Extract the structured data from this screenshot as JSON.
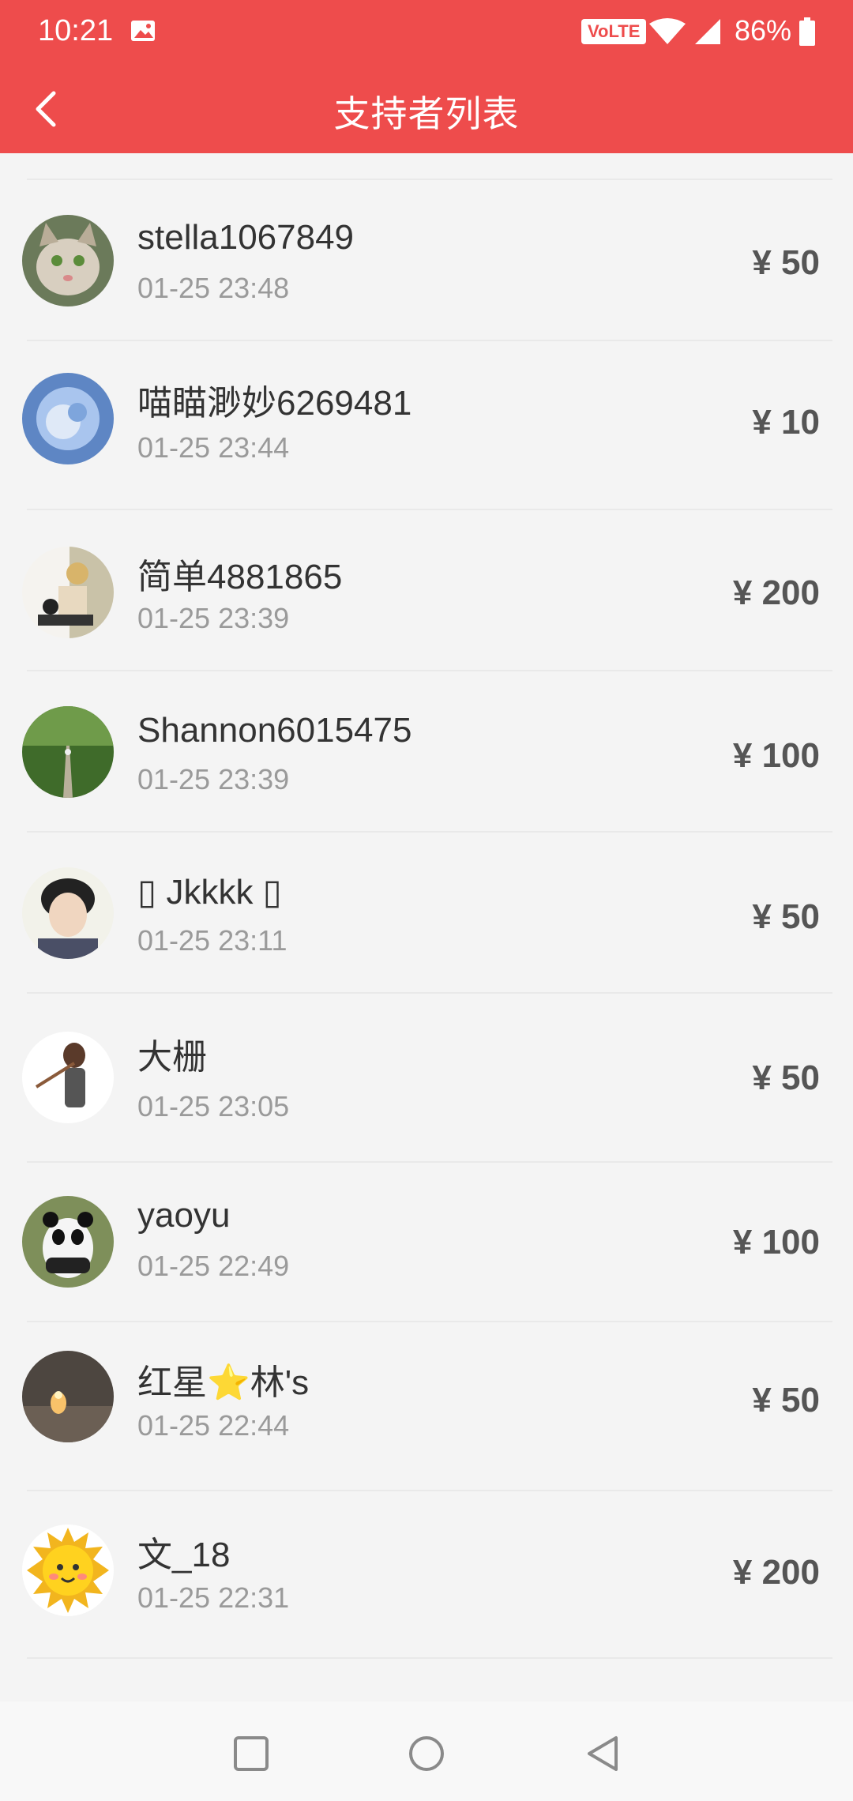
{
  "status": {
    "time": "10:21",
    "volte": "VoLTE",
    "battery": "86%"
  },
  "header": {
    "title": "支持者列表"
  },
  "supporters": [
    {
      "name": "stella1067849",
      "time": "01-25 23:48",
      "amount": "¥ 50"
    },
    {
      "name": "喵瞄渺妙6269481",
      "time": "01-25 23:44",
      "amount": "¥ 10"
    },
    {
      "name": "简单4881865",
      "time": "01-25 23:39",
      "amount": "¥ 200"
    },
    {
      "name": "Shannon6015475",
      "time": "01-25 23:39",
      "amount": "¥ 100"
    },
    {
      "name": "▯ Jkkkk ▯",
      "time": "01-25 23:11",
      "amount": "¥ 50"
    },
    {
      "name": "大栅",
      "time": "01-25 23:05",
      "amount": "¥ 50"
    },
    {
      "name": "yaoyu",
      "time": "01-25 22:49",
      "amount": "¥ 100"
    },
    {
      "name": "红星⭐林's",
      "time": "01-25 22:44",
      "amount": "¥ 50"
    },
    {
      "name": "文_18",
      "time": "01-25 22:31",
      "amount": "¥ 200"
    }
  ],
  "colors": {
    "accent": "#ee4c4c"
  }
}
